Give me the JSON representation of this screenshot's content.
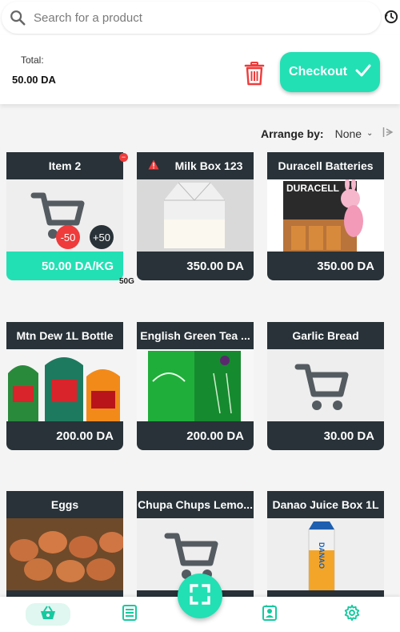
{
  "search": {
    "placeholder": "Search for a product"
  },
  "summary": {
    "total_label": "Total:",
    "total_value": "50.00 DA",
    "checkout_label": "Checkout"
  },
  "arrange": {
    "label": "Arrange by:",
    "value": "None"
  },
  "products": [
    {
      "title": "Item 2",
      "price": "50.00 DA/KG",
      "image": "cart-placeholder",
      "selected": true,
      "minus": "-50",
      "plus": "+50",
      "weight": "50G"
    },
    {
      "title": "Milk Box 123",
      "price": "350.00 DA",
      "image": "milk-carton",
      "warning": true
    },
    {
      "title": "Duracell Batteries",
      "price": "350.00 DA",
      "image": "duracell-pack",
      "image_text": "DURACELL"
    },
    {
      "title": "Mtn Dew 1L Bottle",
      "price": "200.00 DA",
      "image": "mountain-dew-bottles"
    },
    {
      "title": "English Green Tea ...",
      "price": "200.00 DA",
      "image": "green-tea-box"
    },
    {
      "title": "Garlic Bread",
      "price": "30.00 DA",
      "image": "cart-placeholder"
    },
    {
      "title": "Eggs",
      "price": "",
      "image": "eggs-basket"
    },
    {
      "title": "Chupa Chups Lemo...",
      "price": "",
      "image": "cart-placeholder"
    },
    {
      "title": "Danao Juice Box 1L",
      "price": "",
      "image": "danao-juice-box",
      "image_text": "DANAO"
    }
  ],
  "colors": {
    "accent": "#22e0b4",
    "card_dark": "#283238",
    "danger": "#ef3b3b"
  },
  "nav": [
    "basket-icon",
    "list-icon",
    "scan-icon",
    "contacts-icon",
    "settings-icon"
  ]
}
